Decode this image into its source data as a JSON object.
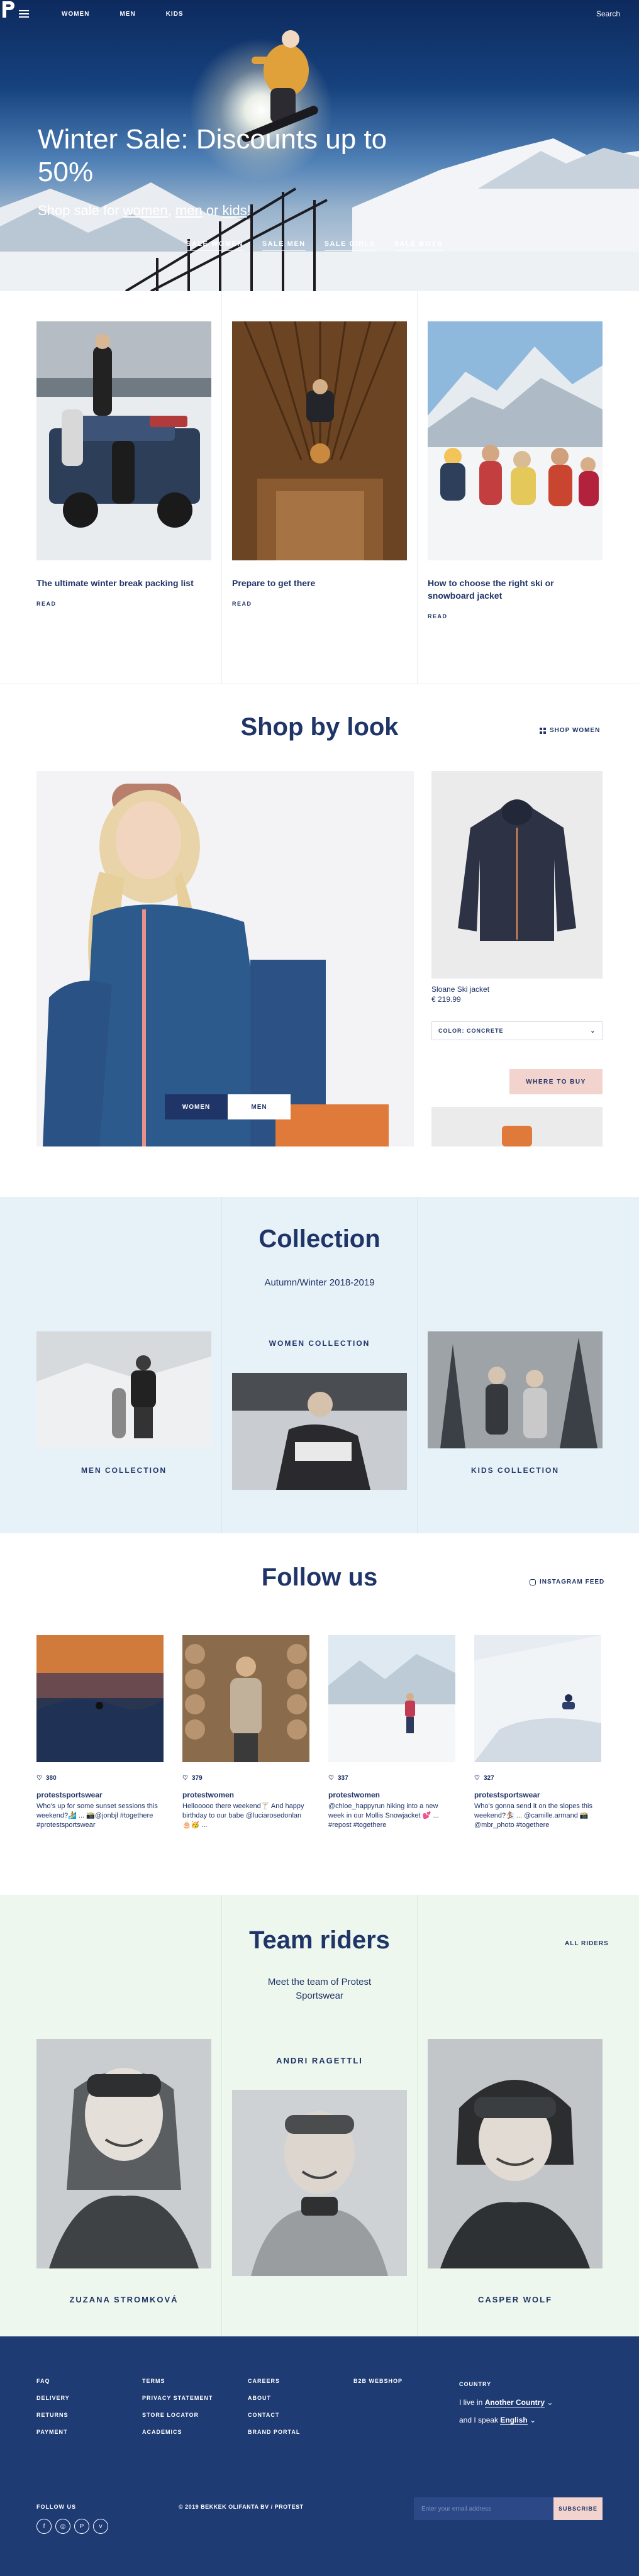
{
  "header": {
    "nav": [
      "WOMEN",
      "MEN",
      "KIDS"
    ],
    "search_label": "Search",
    "logo_icon": "protest-logo-icon",
    "menu_icon": "hamburger-icon"
  },
  "hero": {
    "title": "Winter Sale: Discounts up to 50%",
    "sub_prefix": "Shop sale for ",
    "sub_link1": "women",
    "sub_sep1": ", ",
    "sub_link2": "men",
    "sub_sep2": " or ",
    "sub_link3": "kids",
    "sub_end": "!",
    "ctas": [
      "SALE WOMEN",
      "SALE MEN",
      "SALE GIRLS",
      "SALE BOYS"
    ]
  },
  "articles": [
    {
      "title": "The ultimate winter break packing list",
      "read": "READ"
    },
    {
      "title": "Prepare to get there",
      "read": "READ"
    },
    {
      "title": "How to choose the right ski or snowboard jacket",
      "read": "READ"
    }
  ],
  "look": {
    "title": "Shop by look",
    "shop_link": "SHOP WOMEN",
    "toggle_women": "WOMEN",
    "toggle_men": "MEN",
    "product_name": "Sloane Ski jacket",
    "product_price": "€ 219.99",
    "color_label": "COLOR: CONCRETE",
    "where_to_buy": "WHERE TO BUY"
  },
  "collection": {
    "title": "Collection",
    "subtitle": "Autumn/Winter 2018-2019",
    "men": "MEN COLLECTION",
    "women": "WOMEN COLLECTION",
    "kids": "KIDS COLLECTION"
  },
  "follow": {
    "title": "Follow us",
    "feed_link": "INSTAGRAM FEED",
    "posts": [
      {
        "likes": "380",
        "user": "protestsportswear",
        "caption": "Who's up for some sunset sessions this weekend?🏄 ... 📸@jonbjl #togethere #protestsportswear"
      },
      {
        "likes": "379",
        "user": "protestwomen",
        "caption": "Hellooooo there weekend🍸 And happy birthday to our babe @luciarosedonlan 🎂🥳 ..."
      },
      {
        "likes": "337",
        "user": "protestwomen",
        "caption": "@chloe_happyrun hiking into a new week in our Mollis Snowjacket 💕 ... #repost #togethere"
      },
      {
        "likes": "327",
        "user": "protestsportswear",
        "caption": "Who's gonna send it on the slopes this weekend?🏂 ... @camille.armand 📸@mbr_photo #togethere"
      }
    ]
  },
  "team": {
    "title": "Team riders",
    "subtitle": "Meet the team of Protest Sportswear",
    "all_link": "ALL RIDERS",
    "riders": [
      "ZUZANA STROMKOVÁ",
      "ANDRI RAGETTLI",
      "CASPER WOLF"
    ]
  },
  "footer": {
    "col1": [
      "FAQ",
      "DELIVERY",
      "RETURNS",
      "PAYMENT"
    ],
    "col2": [
      "TERMS",
      "PRIVACY STATEMENT",
      "STORE LOCATOR",
      "ACADEMICS"
    ],
    "col3": [
      "CAREERS",
      "ABOUT",
      "CONTACT",
      "BRAND PORTAL"
    ],
    "col4": [
      "B2B WEBSHOP"
    ],
    "country_label": "COUNTRY",
    "live_prefix": "I live in ",
    "live_value": "Another Country",
    "speak_prefix": "and I speak ",
    "speak_value": "English",
    "follow_label": "FOLLOW US",
    "socials": [
      "facebook-icon",
      "instagram-icon",
      "pinterest-icon",
      "vimeo-icon"
    ],
    "copyright": "© 2019 BEKKEK OLIFANTA BV / PROTEST",
    "email_placeholder": "Enter your email address",
    "subscribe": "SUBSCRIBE"
  }
}
